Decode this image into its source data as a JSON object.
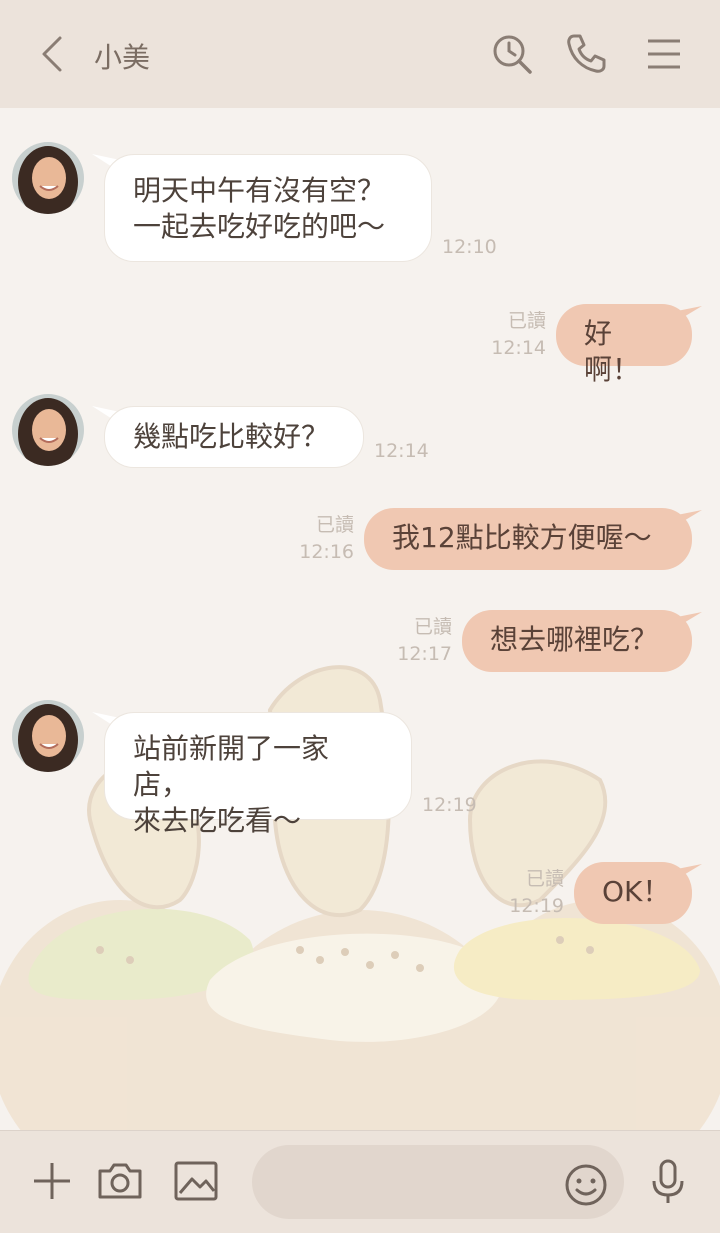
{
  "header": {
    "title": "小美",
    "icons": [
      "back-icon",
      "history-search-icon",
      "phone-icon",
      "menu-icon"
    ]
  },
  "messages": [
    {
      "side": "in",
      "text": "明天中午有沒有空？\n一起去吃好吃的吧～",
      "time": "12:10"
    },
    {
      "side": "out",
      "text": "好啊！",
      "read": "已讀",
      "time": "12:14"
    },
    {
      "side": "in",
      "text": "幾點吃比較好？",
      "time": "12:14"
    },
    {
      "side": "out",
      "text": "我12點比較方便喔～",
      "read": "已讀",
      "time": "12:16"
    },
    {
      "side": "out",
      "text": "想去哪裡吃？",
      "read": "已讀",
      "time": "12:17"
    },
    {
      "side": "in",
      "text": "站前新開了一家店，\n來去吃吃看～",
      "time": "12:19"
    },
    {
      "side": "out",
      "text": "OK！",
      "read": "已讀",
      "time": "12:19"
    }
  ],
  "footer": {
    "input_value": "",
    "icons": [
      "plus-icon",
      "camera-icon",
      "image-icon",
      "emoji-icon",
      "microphone-icon"
    ]
  },
  "colors": {
    "header_bg": "#ece3db",
    "chat_bg": "#f6f2ee",
    "outgoing_bubble": "#f0c8b2",
    "incoming_bubble": "#ffffff"
  }
}
